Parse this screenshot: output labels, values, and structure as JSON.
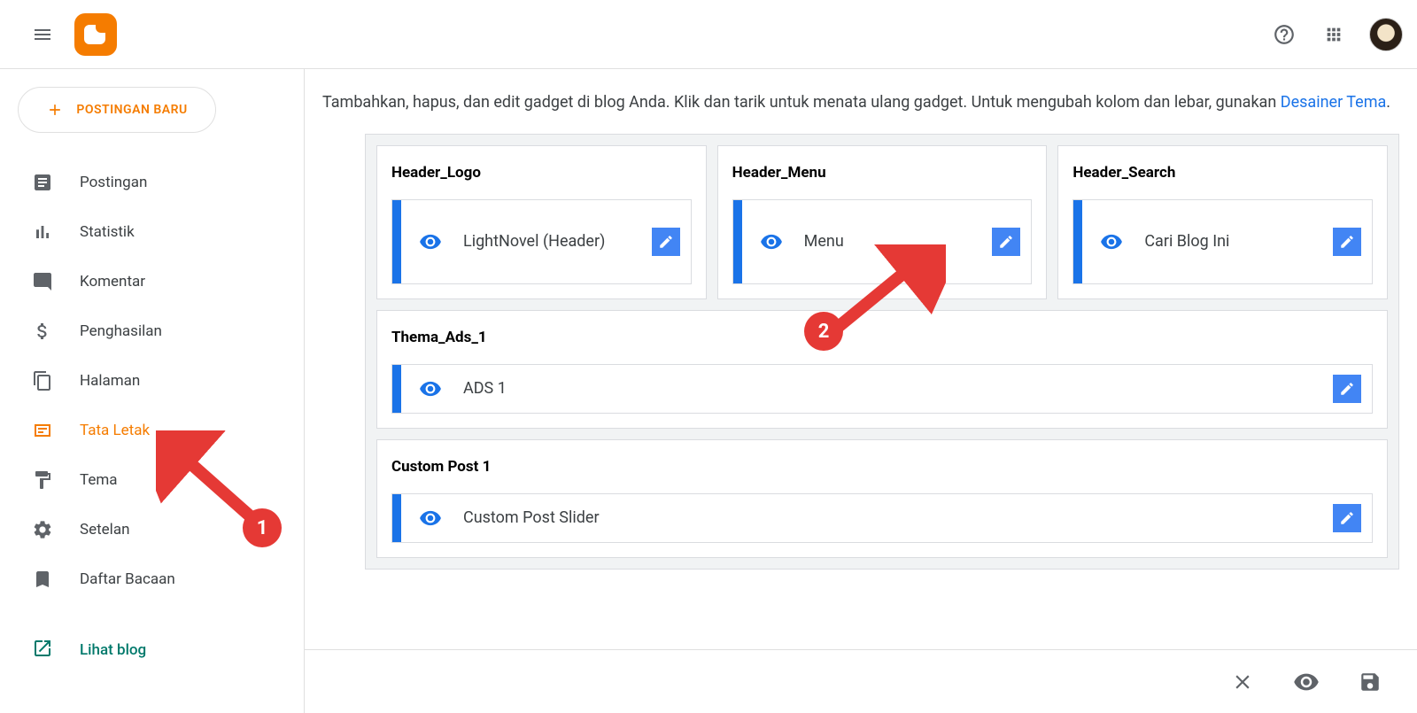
{
  "header": {
    "new_post_label": "POSTINGAN BARU"
  },
  "sidebar": {
    "items": [
      {
        "label": "Postingan",
        "icon": "post"
      },
      {
        "label": "Statistik",
        "icon": "stats"
      },
      {
        "label": "Komentar",
        "icon": "comment"
      },
      {
        "label": "Penghasilan",
        "icon": "dollar"
      },
      {
        "label": "Halaman",
        "icon": "pages"
      },
      {
        "label": "Tata Letak",
        "icon": "layout",
        "active": true
      },
      {
        "label": "Tema",
        "icon": "theme"
      },
      {
        "label": "Setelan",
        "icon": "gear"
      },
      {
        "label": "Daftar Bacaan",
        "icon": "bookmark"
      }
    ],
    "view_blog_label": "Lihat blog"
  },
  "description": {
    "text": "Tambahkan, hapus, dan edit gadget di blog Anda. Klik dan tarik untuk menata ulang gadget. Untuk mengubah kolom dan lebar, gunakan ",
    "link_label": "Desainer Tema"
  },
  "layout": {
    "header_row": [
      {
        "title": "Header_Logo",
        "gadget": "LightNovel (Header)"
      },
      {
        "title": "Header_Menu",
        "gadget": "Menu"
      },
      {
        "title": "Header_Search",
        "gadget": "Cari Blog Ini"
      }
    ],
    "sections": [
      {
        "title": "Thema_Ads_1",
        "gadget": "ADS 1"
      },
      {
        "title": "Custom Post 1",
        "gadget": "Custom Post Slider"
      }
    ]
  },
  "annotations": {
    "marker1": "1",
    "marker2": "2"
  }
}
